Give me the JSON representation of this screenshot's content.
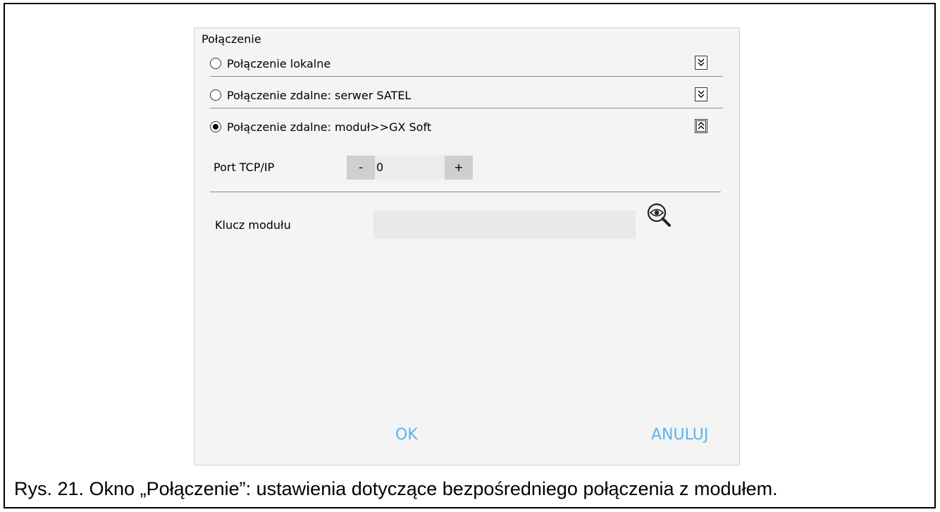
{
  "dialog": {
    "title": "Połączenie",
    "options": [
      {
        "label": "Połączenie lokalne",
        "selected": false,
        "expand_icon": "double-chevron-down-icon"
      },
      {
        "label": "Połączenie zdalne: serwer SATEL",
        "selected": false,
        "expand_icon": "double-chevron-down-icon"
      },
      {
        "label": "Połączenie zdalne: moduł>>GX Soft",
        "selected": true,
        "expand_icon": "double-chevron-up-icon"
      }
    ],
    "port": {
      "label": "Port TCP/IP",
      "minus_label": "-",
      "value": "0",
      "plus_label": "+"
    },
    "module_key": {
      "label": "Klucz modułu",
      "value": "",
      "icon": "show-password-magnifier-icon"
    },
    "ok_label": "OK",
    "cancel_label": "ANULUJ",
    "accent_color": "#5ab4f0"
  },
  "caption": "Rys. 21. Okno „Połączenie”: ustawienia dotyczące bezpośredniego połączenia z modułem."
}
